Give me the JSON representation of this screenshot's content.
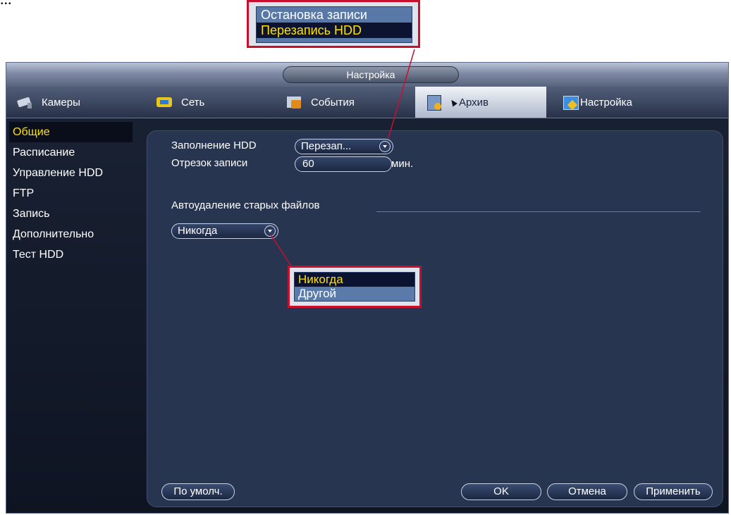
{
  "caption": "...",
  "callout_top": {
    "options": [
      "Остановка записи",
      "Перезапись HDD"
    ],
    "selected_index": 1
  },
  "window": {
    "title": "Настройка",
    "tabs": [
      {
        "label": "Камеры",
        "icon": "camera-icon"
      },
      {
        "label": "Сеть",
        "icon": "network-icon"
      },
      {
        "label": "События",
        "icon": "events-icon"
      },
      {
        "label": "Архив",
        "icon": "archive-icon",
        "active": true
      },
      {
        "label": "Настройка",
        "icon": "settings-icon"
      }
    ],
    "sidebar": [
      {
        "label": "Общие",
        "active": true
      },
      {
        "label": "Расписание"
      },
      {
        "label": "Управление HDD"
      },
      {
        "label": "FTP"
      },
      {
        "label": "Запись"
      },
      {
        "label": "Дополнительно"
      },
      {
        "label": "Тест HDD"
      }
    ],
    "form": {
      "hdd_fill_label": "Заполнение HDD",
      "hdd_fill_value": "Перезап...",
      "segment_label": "Отрезок записи",
      "segment_value": "60",
      "segment_unit": "мин.",
      "autodelete_label": "Автоудаление старых файлов",
      "autodelete_value": "Никогда"
    },
    "buttons": {
      "default": "По умолч.",
      "ok": "OK",
      "cancel": "Отмена",
      "apply": "Применить"
    }
  },
  "callout_mid": {
    "options": [
      "Никогда",
      "Другой"
    ],
    "selected_index": 0
  },
  "colors": {
    "accent_yellow": "#ffe000",
    "callout_border": "#c8102e",
    "panel_bg": "#273551"
  }
}
